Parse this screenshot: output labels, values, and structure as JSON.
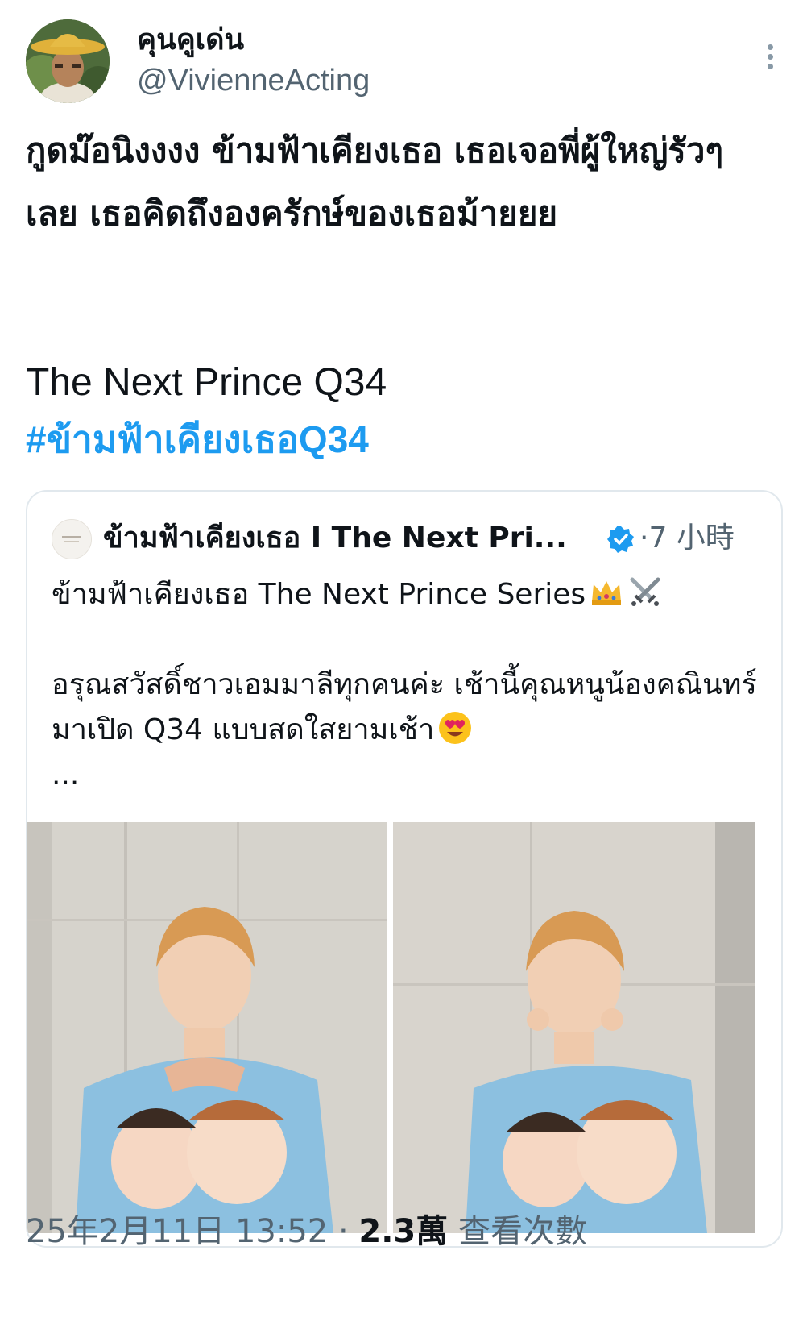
{
  "author": {
    "display_name": "คุนคูเด่น",
    "handle": "@VivienneActing",
    "avatar_icon": "profile-photo-straw-hat"
  },
  "tweet": {
    "text": "กูดม๊อนิงงงง ข้ามฟ้าเคียงเธอ เธอเจอพี่ผู้ใหญ่รัวๆ เลย เธอคิดถึงองครักษ์ของเธอม้ายยย",
    "line2": "The Next Prince Q34",
    "hashtag": "#ข้ามฟ้าเคียงเธอQ34"
  },
  "quoted": {
    "name": "ข้ามฟ้าเคียงเธอ I The Next Pri...",
    "verified_icon": "verified-badge-icon",
    "time": "·7 小時",
    "text_line1": "ข้ามฟ้าเคียงเธอ The Next Prince Series",
    "text_line2": "อรุณสวัสดิ์ชาวเอมมาลีทุกคนค่ะ เช้านี้คุณหนูน้องคณินทร์มาเปิด Q34 แบบสดใสยามเช้า",
    "ellipsis": "...",
    "emojis": [
      "crown-emoji",
      "crossed-swords-emoji",
      "heart-eyes-emoji"
    ],
    "photos": [
      "photo-heart-hands",
      "photo-finger-cheeks"
    ]
  },
  "meta": {
    "timestamp": "25年2月11日 13:52",
    "separator": " · ",
    "views_count": "2.3萬",
    "views_label": "查看次數"
  },
  "colors": {
    "hashtag": "#1d9bf0",
    "secondary_text": "#536471",
    "verified": "#1d9bf0"
  }
}
